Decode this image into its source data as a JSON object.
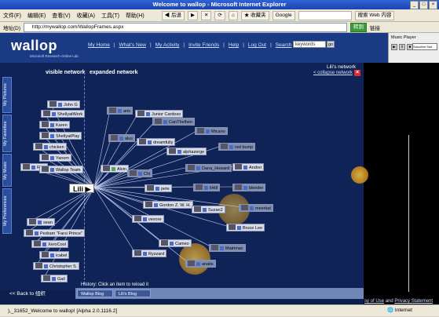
{
  "window": {
    "title": "Welcome to wallop - Microsoft Internet Explorer"
  },
  "menu": {
    "items": [
      "文件(F)",
      "编辑(E)",
      "查看(V)",
      "收藏(A)",
      "工具(T)",
      "帮助(H)"
    ],
    "back_label": "后退",
    "favorites_label": "收藏夹",
    "google_label": "Google",
    "search_label": "搜索 Web 内容"
  },
  "address": {
    "label": "地址(D)",
    "url": "http://mywallop.com/WallopFrames.aspx",
    "go_label": "转到",
    "links_label": "链接"
  },
  "header": {
    "logo": "wallop",
    "logo_sub": "Microsoft Research Online Lab",
    "nav": [
      "My Home",
      "What's New",
      "My Activity",
      "Invite Friends",
      "Help",
      "Log Out",
      "Search"
    ],
    "search_value": "keywords",
    "search_go": "go",
    "player_title": "Music Player",
    "player_select": "Suscríbe! Not"
  },
  "sidebar": {
    "tabs": [
      "My Pictures",
      "My Favorites",
      "My Music",
      "My Preferences"
    ]
  },
  "network": {
    "visible_heading": "visible network",
    "expanded_heading": "expanded network",
    "owner_title": "Lili's network",
    "collapse_label": "< collapse network",
    "close": "×",
    "center": "Lili ▶",
    "visible_nodes": [
      "John G",
      "ShellyatWork",
      "Karen",
      "ShellyatPlay",
      "chicken",
      "Yanom",
      "Rick",
      "Wallop Team",
      "sean",
      "Pedram \"Farsi Prince\"",
      "XeroCool",
      "icabel",
      "Christopher S.",
      "Gail"
    ],
    "expanded_nodes": [
      "ario",
      "Junior Cardoso",
      "CanThelhen",
      "Micano",
      "alus",
      "dreamfully",
      "red bump",
      "alphazerge",
      "Alvin",
      "Dana_Howard",
      "Andrei",
      "Chi",
      "pete",
      "liHill",
      "blender",
      "Gordon Z. W. H.",
      "Suzan2",
      "meerkat",
      "vevore",
      "Bruce Lee",
      "Cameo",
      "Matrimac",
      "Ryzzard",
      "anatis"
    ]
  },
  "history": {
    "label": "History: Click an item to reload it",
    "tabs": [
      "Wallop Blog",
      "Lili's Blog"
    ]
  },
  "footer": {
    "back_link": "<< Back to 组织",
    "terms_prefix": "sy of Use",
    "and": "and",
    "privacy": "Privacy Statement"
  },
  "status": {
    "text": "),_31652_Welcome to wallop! [Alpha 2.0.1116.2]",
    "zone": "Internet"
  }
}
